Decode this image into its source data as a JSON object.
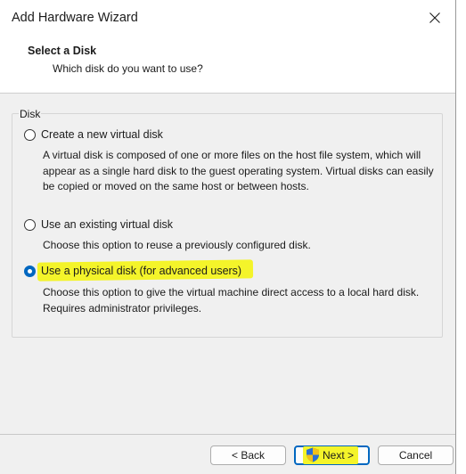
{
  "window": {
    "title": "Add Hardware Wizard"
  },
  "header": {
    "title": "Select a Disk",
    "subtitle": "Which disk do you want to use?"
  },
  "group": {
    "label": "Disk"
  },
  "options": [
    {
      "label": "Create a new virtual disk",
      "checked": false,
      "description": "A virtual disk is composed of one or more files on the host file system, which will appear as a single hard disk to the guest operating system. Virtual disks can easily be copied or moved on the same host or between hosts."
    },
    {
      "label": "Use an existing virtual disk",
      "checked": false,
      "description": "Choose this option to reuse a previously configured disk."
    },
    {
      "label": "Use a physical disk (for advanced users)",
      "checked": true,
      "description": "Choose this option to give the virtual machine direct access to a local hard disk. Requires administrator privileges."
    }
  ],
  "buttons": {
    "back": "< Back",
    "next": "Next >",
    "cancel": "Cancel"
  },
  "colors": {
    "highlight": "#f4f42a",
    "accent": "#0067c0"
  }
}
